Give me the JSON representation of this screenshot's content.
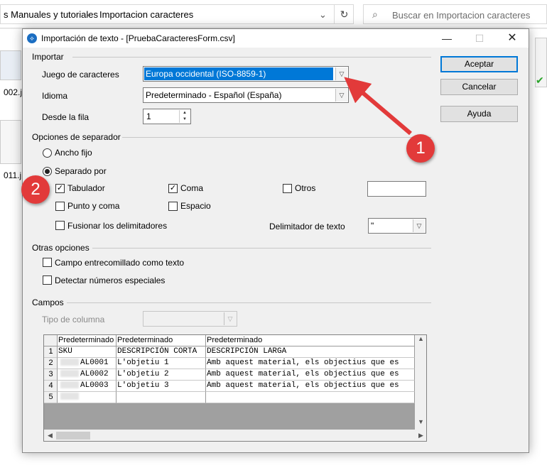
{
  "explorer": {
    "breadcrumb_1": "s Manuales y tutoriales",
    "breadcrumb_sep": "›",
    "breadcrumb_2": "Importacion caracteres",
    "search_placeholder": "Buscar en Importacion caracteres",
    "files": [
      "002.j",
      "011.j"
    ]
  },
  "dialog": {
    "title": "Importación de texto - [PruebaCaracteresForm.csv]",
    "import_section": "Importar",
    "charset_label": "Juego de caracteres",
    "charset_value": "Europa occidental (ISO-8859-1)",
    "language_label": "Idioma",
    "language_value": "Predeterminado - Español (España)",
    "from_row_label": "Desde la fila",
    "from_row_value": "1",
    "separator_section": "Opciones de separador",
    "fixed_width_label": "Ancho fijo",
    "separated_by_label": "Separado por",
    "tab_label": "Tabulador",
    "comma_label": "Coma",
    "other_label": "Otros",
    "semicolon_label": "Punto y coma",
    "space_label": "Espacio",
    "merge_label": "Fusionar los delimitadores",
    "text_delim_label": "Delimitador de texto",
    "text_delim_value": "\"",
    "other_section": "Otras opciones",
    "quoted_label": "Campo entrecomillado como texto",
    "detect_label": "Detectar números especiales",
    "fields_section": "Campos",
    "column_type_label": "Tipo de columna",
    "buttons": {
      "ok": "Aceptar",
      "cancel": "Cancelar",
      "help": "Ayuda"
    },
    "checks": {
      "tab": true,
      "comma": true,
      "other": false,
      "semicolon": false,
      "space": false,
      "merge": false,
      "quoted": false,
      "detect": false
    }
  },
  "grid": {
    "headers": [
      "Predeterminado",
      "Predeterminado",
      "Predeterminado"
    ],
    "rows": [
      {
        "n": "1",
        "c1": "SKU",
        "c2": "DESCRIPCIÓN CORTA",
        "c3": "DESCRIPCIÓN LARGA"
      },
      {
        "n": "2",
        "c1": "AL0001",
        "c2": "L'objetiu 1",
        "c3": "Amb aquest material, els objectius que es"
      },
      {
        "n": "3",
        "c1": "AL0002",
        "c2": "L'objetiu 2",
        "c3": "Amb aquest material, els objectius que es"
      },
      {
        "n": "4",
        "c1": "AL0003",
        "c2": "L'objetiu 3",
        "c3": "Amb aquest material, els objectius que es"
      },
      {
        "n": "5",
        "c1": "",
        "c2": "",
        "c3": ""
      }
    ]
  },
  "annotations": {
    "badge_1": "1",
    "badge_2": "2"
  }
}
